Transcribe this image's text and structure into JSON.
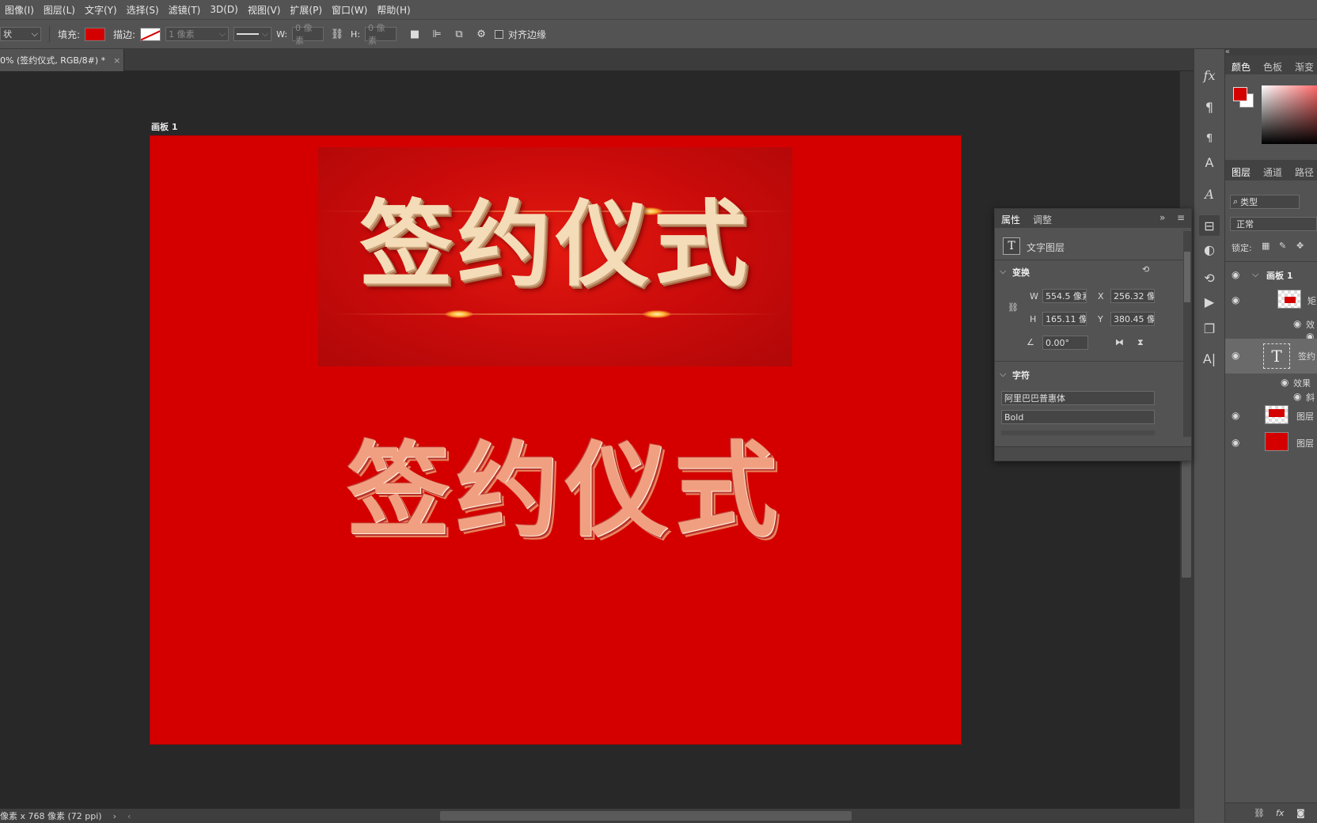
{
  "menubar": {
    "items": [
      "图像(I)",
      "图层(L)",
      "文字(Y)",
      "选择(S)",
      "滤镜(T)",
      "3D(D)",
      "视图(V)",
      "扩展(P)",
      "窗口(W)",
      "帮助(H)"
    ]
  },
  "options": {
    "shape_mode": "状",
    "fill_label": "填充:",
    "fill_color": "#d40000",
    "stroke_label": "描边:",
    "stroke_width": "1 像素",
    "w_label": "W:",
    "w_value": "0 像素",
    "h_label": "H:",
    "h_value": "0 像素",
    "align_edges_label": "对齐边缘",
    "align_edges_checked": false
  },
  "document": {
    "tab_title": "0% (签约仪式, RGB/8#) *",
    "artboard_label": "画板 1",
    "banner_text": "签约仪式",
    "main_text": "签约仪式"
  },
  "status": {
    "text": "像素 x 768 像素 (72 ppi)"
  },
  "right_panel": {
    "color_tabs": [
      "颜色",
      "色板",
      "渐变"
    ],
    "layer_tabs": [
      "图层",
      "通道",
      "路径"
    ],
    "filter_label": "类型",
    "blend_mode": "正常",
    "lock_label": "锁定:",
    "layers": [
      {
        "name": "画板 1",
        "type": "artboard"
      },
      {
        "name": "矩",
        "type": "shape"
      },
      {
        "name": "效",
        "type": "effect"
      },
      {
        "name": "签约",
        "type": "text"
      },
      {
        "name": "效果",
        "type": "effect"
      },
      {
        "name": "斜",
        "type": "effect"
      },
      {
        "name": "图层",
        "type": "image"
      },
      {
        "name": "图层",
        "type": "fill"
      }
    ]
  },
  "properties": {
    "tabs": [
      "属性",
      "调整"
    ],
    "layer_kind": "文字图层",
    "transform_label": "变换",
    "w_label": "W",
    "w_value": "554.5 像素",
    "x_label": "X",
    "x_value": "256.32 像",
    "h_label": "H",
    "h_value": "165.11 像",
    "y_label": "Y",
    "y_value": "380.45 像",
    "angle_value": "0.00°",
    "character_label": "字符",
    "font_family": "阿里巴巴普惠体",
    "font_style": "Bold"
  }
}
